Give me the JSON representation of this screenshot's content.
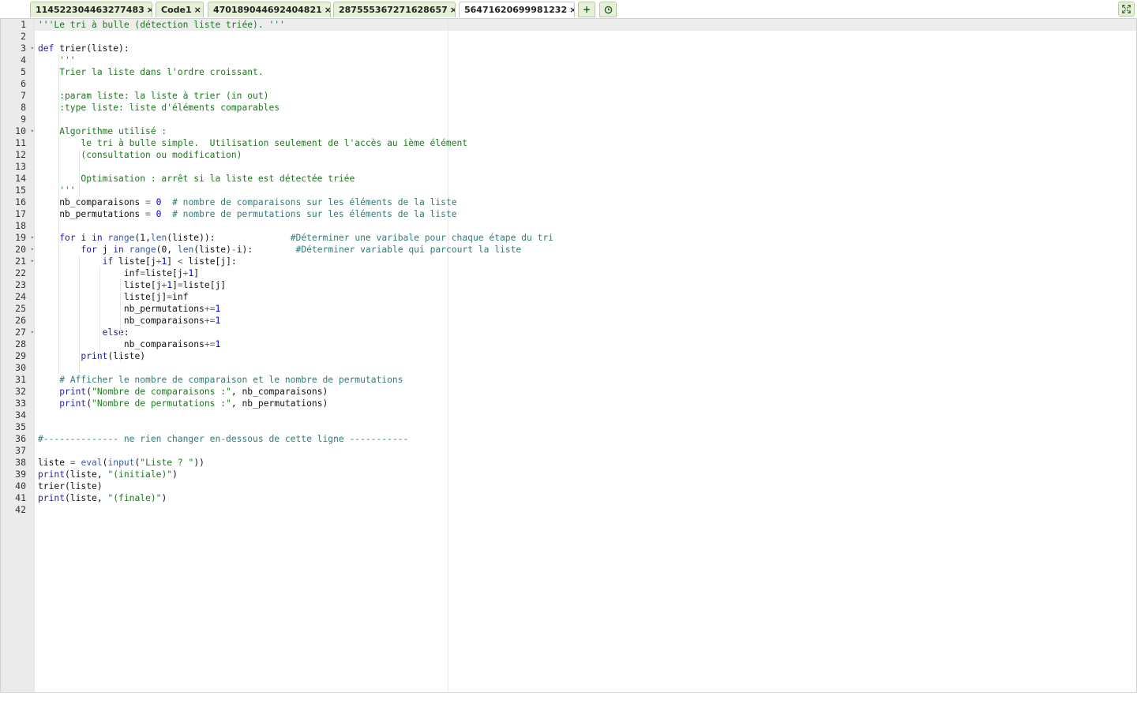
{
  "tabs": [
    {
      "label": "114522304463277483",
      "active": false
    },
    {
      "label": "Code1",
      "active": false
    },
    {
      "label": "470189044692404821",
      "active": false
    },
    {
      "label": "287555367271628657",
      "active": false
    },
    {
      "label": "56471620699981232",
      "active": true
    }
  ],
  "tab_close_glyph": "×",
  "tab_actions": {
    "add_label": "+",
    "history_icon": "clock-icon",
    "fullscreen_icon": "expand-icon"
  },
  "editor": {
    "active_line": 1,
    "fold_lines": [
      3,
      10,
      19,
      20,
      21,
      27
    ],
    "lines": [
      [
        [
          "str",
          "'''Le tri à bulle (détection liste triée). '''"
        ]
      ],
      [],
      [
        [
          "kw",
          "def"
        ],
        [
          "txt",
          " trier(liste):"
        ]
      ],
      [
        [
          "str",
          "    '''"
        ]
      ],
      [
        [
          "str",
          "    Trier la liste dans l'ordre croissant."
        ]
      ],
      [],
      [
        [
          "str",
          "    :param liste: la liste à trier (in out)"
        ]
      ],
      [
        [
          "str",
          "    :type liste: liste d'éléments comparables"
        ]
      ],
      [],
      [
        [
          "str",
          "    Algorithme utilisé :"
        ]
      ],
      [
        [
          "str",
          "        le tri à bulle simple.  Utilisation seulement de l'accès au ième élément"
        ]
      ],
      [
        [
          "str",
          "        (consultation ou modification)"
        ]
      ],
      [],
      [
        [
          "str",
          "        Optimisation : arrêt si la liste est détectée triée"
        ]
      ],
      [
        [
          "str",
          "    '''"
        ]
      ],
      [
        [
          "txt",
          "    nb_comparaisons "
        ],
        [
          "op",
          "="
        ],
        [
          "txt",
          " "
        ],
        [
          "num",
          "0"
        ],
        [
          "txt",
          "  "
        ],
        [
          "cmt",
          "# nombre de comparaisons sur les éléments de la liste"
        ]
      ],
      [
        [
          "txt",
          "    nb_permutations "
        ],
        [
          "op",
          "="
        ],
        [
          "txt",
          " "
        ],
        [
          "num",
          "0"
        ],
        [
          "txt",
          "  "
        ],
        [
          "cmt",
          "# nombre de permutations sur les éléments de la liste"
        ]
      ],
      [],
      [
        [
          "txt",
          "    "
        ],
        [
          "kw",
          "for"
        ],
        [
          "txt",
          " i "
        ],
        [
          "kw",
          "in"
        ],
        [
          "txt",
          " "
        ],
        [
          "fn",
          "range"
        ],
        [
          "txt",
          "(1,"
        ],
        [
          "fn",
          "len"
        ],
        [
          "txt",
          "(liste)):              "
        ],
        [
          "cmt",
          "#Déterminer une varibale pour chaque étape du tri"
        ]
      ],
      [
        [
          "txt",
          "        "
        ],
        [
          "kw",
          "for"
        ],
        [
          "txt",
          " j "
        ],
        [
          "kw",
          "in"
        ],
        [
          "txt",
          " "
        ],
        [
          "fn",
          "range"
        ],
        [
          "txt",
          "(0, "
        ],
        [
          "fn",
          "len"
        ],
        [
          "txt",
          "(liste)"
        ],
        [
          "op",
          "-"
        ],
        [
          "txt",
          "i):        "
        ],
        [
          "cmt",
          "#Déterminer variable qui parcourt la liste"
        ]
      ],
      [
        [
          "txt",
          "            "
        ],
        [
          "kw",
          "if"
        ],
        [
          "txt",
          " liste[j"
        ],
        [
          "op",
          "+"
        ],
        [
          "num",
          "1"
        ],
        [
          "txt",
          "] "
        ],
        [
          "op",
          "<"
        ],
        [
          "txt",
          " liste[j]:"
        ]
      ],
      [
        [
          "txt",
          "                inf"
        ],
        [
          "op",
          "="
        ],
        [
          "txt",
          "liste[j"
        ],
        [
          "op",
          "+"
        ],
        [
          "num",
          "1"
        ],
        [
          "txt",
          "]"
        ]
      ],
      [
        [
          "txt",
          "                liste[j"
        ],
        [
          "op",
          "+"
        ],
        [
          "num",
          "1"
        ],
        [
          "txt",
          "]"
        ],
        [
          "op",
          "="
        ],
        [
          "txt",
          "liste[j]"
        ]
      ],
      [
        [
          "txt",
          "                liste[j]"
        ],
        [
          "op",
          "="
        ],
        [
          "txt",
          "inf"
        ]
      ],
      [
        [
          "txt",
          "                nb_permutations"
        ],
        [
          "op",
          "+="
        ],
        [
          "num",
          "1"
        ]
      ],
      [
        [
          "txt",
          "                nb_comparaisons"
        ],
        [
          "op",
          "+="
        ],
        [
          "num",
          "1"
        ]
      ],
      [
        [
          "txt",
          "            "
        ],
        [
          "kw",
          "else"
        ],
        [
          "txt",
          ":"
        ]
      ],
      [
        [
          "txt",
          "                nb_comparaisons"
        ],
        [
          "op",
          "+="
        ],
        [
          "num",
          "1"
        ]
      ],
      [
        [
          "txt",
          "        "
        ],
        [
          "kw",
          "print"
        ],
        [
          "txt",
          "(liste)"
        ]
      ],
      [],
      [
        [
          "txt",
          "    "
        ],
        [
          "cmt",
          "# Afficher le nombre de comparaison et le nombre de permutations"
        ]
      ],
      [
        [
          "txt",
          "    "
        ],
        [
          "kw",
          "print"
        ],
        [
          "txt",
          "("
        ],
        [
          "str",
          "\"Nombre de comparaisons :\""
        ],
        [
          "txt",
          ", nb_comparaisons)"
        ]
      ],
      [
        [
          "txt",
          "    "
        ],
        [
          "kw",
          "print"
        ],
        [
          "txt",
          "("
        ],
        [
          "str",
          "\"Nombre de permutations :\""
        ],
        [
          "txt",
          ", nb_permutations)"
        ]
      ],
      [],
      [],
      [
        [
          "cmt",
          "#-------------- ne rien changer en-dessous de cette ligne -----------"
        ]
      ],
      [],
      [
        [
          "txt",
          "liste "
        ],
        [
          "op",
          "="
        ],
        [
          "txt",
          " "
        ],
        [
          "fn",
          "eval"
        ],
        [
          "txt",
          "("
        ],
        [
          "fn",
          "input"
        ],
        [
          "txt",
          "("
        ],
        [
          "str",
          "\"Liste ? \""
        ],
        [
          "txt",
          "))"
        ]
      ],
      [
        [
          "kw",
          "print"
        ],
        [
          "txt",
          "(liste, "
        ],
        [
          "str",
          "\"(initiale)\""
        ],
        [
          "txt",
          ")"
        ]
      ],
      [
        [
          "txt",
          "trier(liste)"
        ]
      ],
      [
        [
          "kw",
          "print"
        ],
        [
          "txt",
          "(liste, "
        ],
        [
          "str",
          "\"(finale)\""
        ],
        [
          "txt",
          ")"
        ]
      ],
      []
    ]
  }
}
